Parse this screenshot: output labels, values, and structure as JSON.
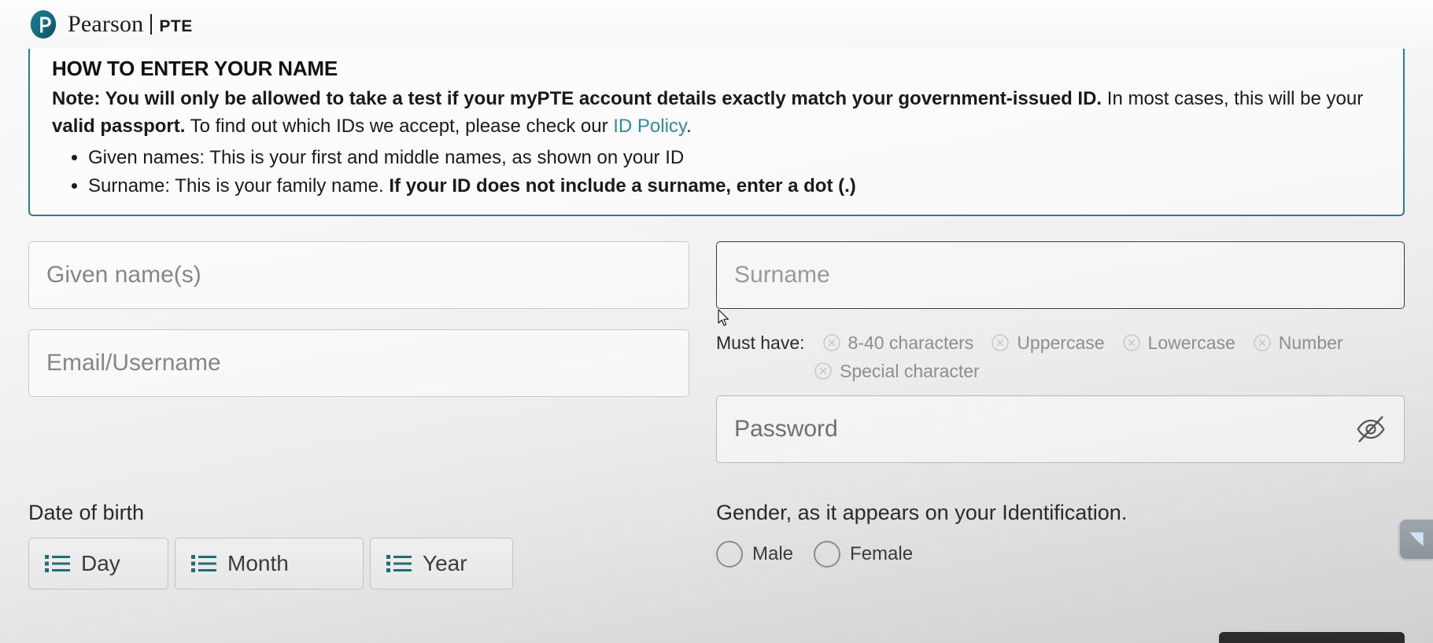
{
  "header": {
    "brand_name": "Pearson",
    "product": "PTE",
    "logo_icon": "pearson-p-logo"
  },
  "notice": {
    "title": "HOW TO ENTER YOUR NAME",
    "note_bold_1": "Note: You will only be allowed to take a test if your myPTE account details exactly match your government-issued ID.",
    "note_plain_1": " In most cases, this will be your ",
    "note_bold_2": "valid passport.",
    "note_plain_2": " To find out which IDs we accept, please check our ",
    "link_label": "ID Policy",
    "note_plain_3": ".",
    "bullets": [
      {
        "plain": "Given names: This is your first and middle names, as shown on your ID",
        "bold": ""
      },
      {
        "plain": "Surname: This is your family name. ",
        "bold": "If your ID does not include a surname, enter a dot (.)"
      }
    ],
    "border_color": "#2f7d85",
    "link_color": "#2f8d97"
  },
  "form": {
    "given_name": {
      "placeholder": "Given name(s)",
      "value": ""
    },
    "surname": {
      "placeholder": "Surname",
      "value": "",
      "focused": true
    },
    "email": {
      "placeholder": "Email/Username",
      "value": ""
    },
    "password": {
      "placeholder": "Password",
      "value": "",
      "toggle_icon": "eye-off-icon"
    },
    "must_have_label": "Must have:",
    "requirements": [
      {
        "label": "8-40 characters",
        "met": false,
        "icon": "circle-x-icon"
      },
      {
        "label": "Uppercase",
        "met": false,
        "icon": "circle-x-icon"
      },
      {
        "label": "Lowercase",
        "met": false,
        "icon": "circle-x-icon"
      },
      {
        "label": "Number",
        "met": false,
        "icon": "circle-x-icon"
      },
      {
        "label": "Special character",
        "met": false,
        "icon": "circle-x-icon"
      }
    ]
  },
  "dob": {
    "label": "Date of birth",
    "day": {
      "label": "Day",
      "icon": "list-icon"
    },
    "month": {
      "label": "Month",
      "icon": "list-icon"
    },
    "year": {
      "label": "Year",
      "icon": "list-icon"
    }
  },
  "gender": {
    "label": "Gender, as it appears on your Identification.",
    "options": [
      {
        "label": "Male",
        "selected": false
      },
      {
        "label": "Female",
        "selected": false
      }
    ]
  },
  "misc": {
    "side_widget_icon": "feedback-widget-icon",
    "accent_teal": "#2f7d85",
    "placeholder_gray": "#868686"
  }
}
